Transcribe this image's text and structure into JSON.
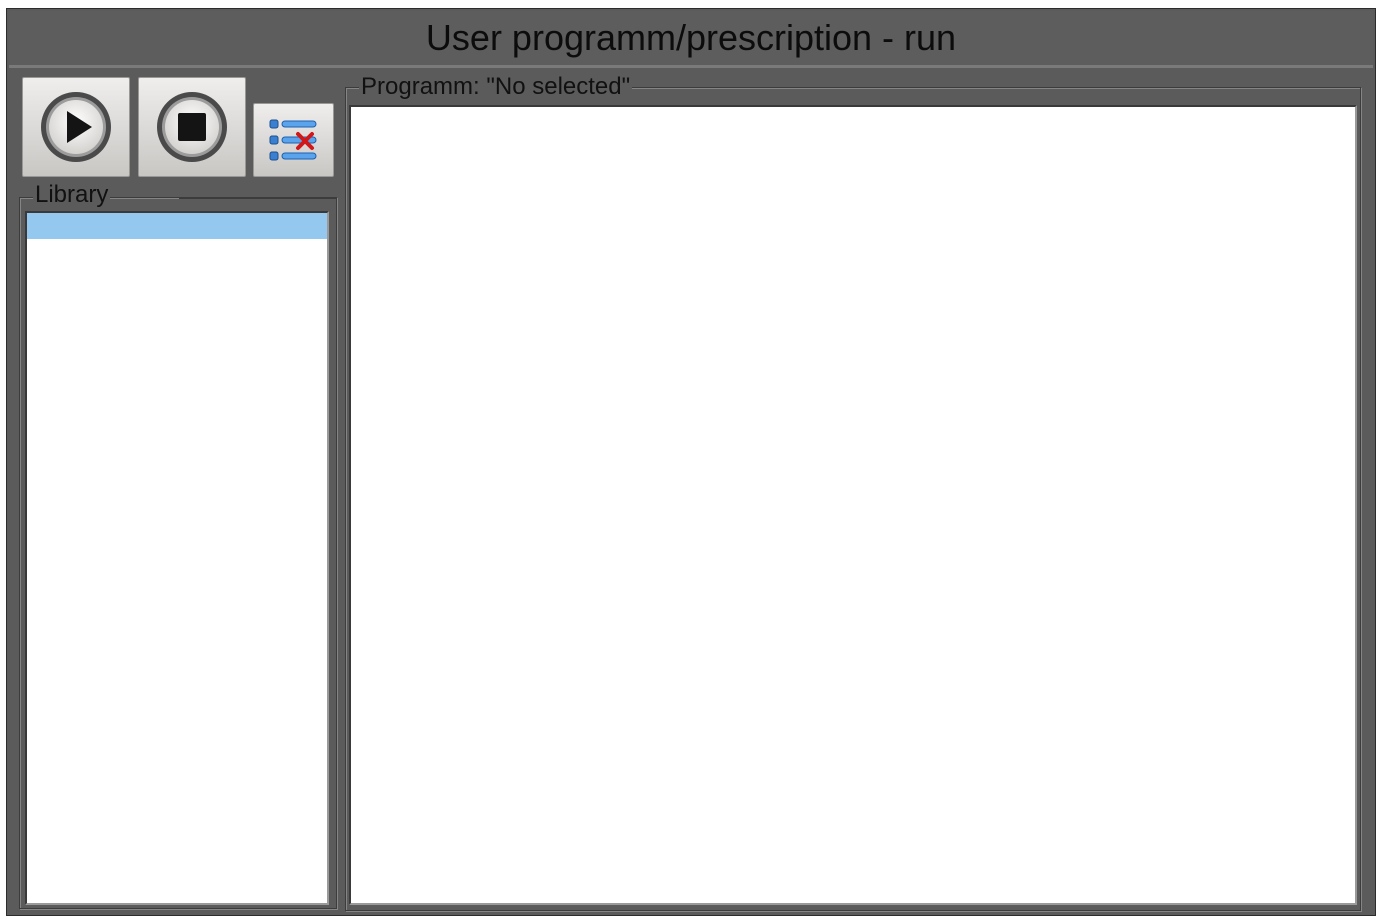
{
  "window": {
    "title": "User programm/prescription - run"
  },
  "toolbar": {
    "run_icon": "play-icon",
    "stop_icon": "stop-icon",
    "clear_icon": "list-remove-icon"
  },
  "library": {
    "legend": "Library"
  },
  "program": {
    "legend": "Programm: \"No selected\""
  },
  "colors": {
    "window_bg": "#5b5b5b",
    "selection": "#94c8ee",
    "list_bg": "#ffffff"
  }
}
